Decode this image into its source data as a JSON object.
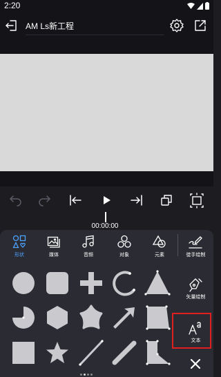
{
  "status": {
    "time": "2:20"
  },
  "header": {
    "title": "AM Ls新工程"
  },
  "timeline": {
    "timecode": "00:00:00"
  },
  "categories": [
    {
      "label": "形状",
      "icon": "shapes-icon",
      "active": true
    },
    {
      "label": "媒体",
      "icon": "media-icon",
      "active": false
    },
    {
      "label": "音频",
      "icon": "music-note-icon",
      "active": false
    },
    {
      "label": "对象",
      "icon": "objects-icon",
      "active": false
    },
    {
      "label": "元素",
      "icon": "elements-icon",
      "active": false
    }
  ],
  "side_tools": [
    {
      "label": "徒手绘制",
      "icon": "freehand-draw-icon"
    },
    {
      "label": "矢量绘制",
      "icon": "vector-pen-icon"
    },
    {
      "label": "文本",
      "icon": "text-icon"
    }
  ],
  "shapes": [
    "circle-shape",
    "rounded-square-shape",
    "plus-shape",
    "arc-shape",
    "triangle-shape",
    "pie-shape",
    "hexagon-shape",
    "blob-star-shape",
    "arrow-shape",
    "trapezoid-shape",
    "square-shape",
    "star-shape",
    "line-shape",
    "thick-line-shape",
    "polygon-shape"
  ],
  "colors": {
    "accent": "#4da3ff",
    "highlight": "#e02020",
    "canvas": "#d9d9d9",
    "panel": "#2b2b33"
  },
  "pager": {
    "count": 4,
    "active": 1
  }
}
